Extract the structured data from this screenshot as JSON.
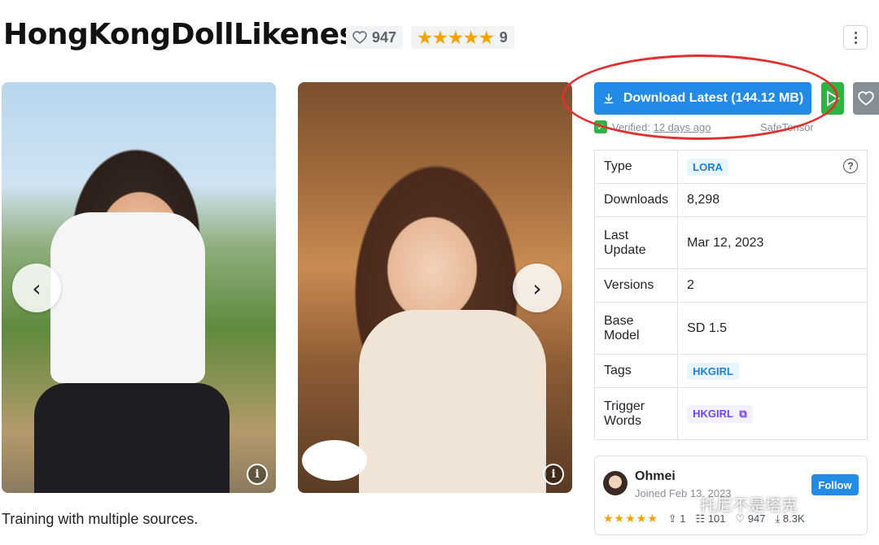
{
  "model": {
    "title": "HongKongDollLikeness",
    "likes": "947",
    "rating_count": "9",
    "rating_stars": "★★★★★"
  },
  "gallery": {
    "prev_icon": "‹",
    "next_icon": "›",
    "info_icon": "i"
  },
  "description": "Training with multiple sources.",
  "actions": {
    "download_label": "Download Latest (144.12 MB)",
    "verified_label": "Verified:",
    "verified_time": "12 days ago",
    "file_format": "SafeTensor"
  },
  "details": {
    "rows": [
      {
        "key": "Type",
        "value": "LORA"
      },
      {
        "key": "Downloads",
        "value": "8,298"
      },
      {
        "key": "Last Update",
        "value": "Mar 12, 2023"
      },
      {
        "key": "Versions",
        "value": "2"
      },
      {
        "key": "Base Model",
        "value": "SD 1.5"
      },
      {
        "key": "Tags",
        "value": "HKGIRL"
      },
      {
        "key": "Trigger Words",
        "value": "HKGIRL"
      }
    ]
  },
  "creator": {
    "name": "Ohmei",
    "joined": "Joined Feb 13, 2023",
    "follow_label": "Follow",
    "stars": "★★★★★",
    "uploads": "1",
    "reviews": "101",
    "likes": "947",
    "downloads": "8.3K"
  },
  "watermark": "托尼不是塔克",
  "colors": {
    "primary": "#228be6",
    "success": "#2fb344",
    "star": "#f5a300",
    "annotation": "#e03131"
  }
}
